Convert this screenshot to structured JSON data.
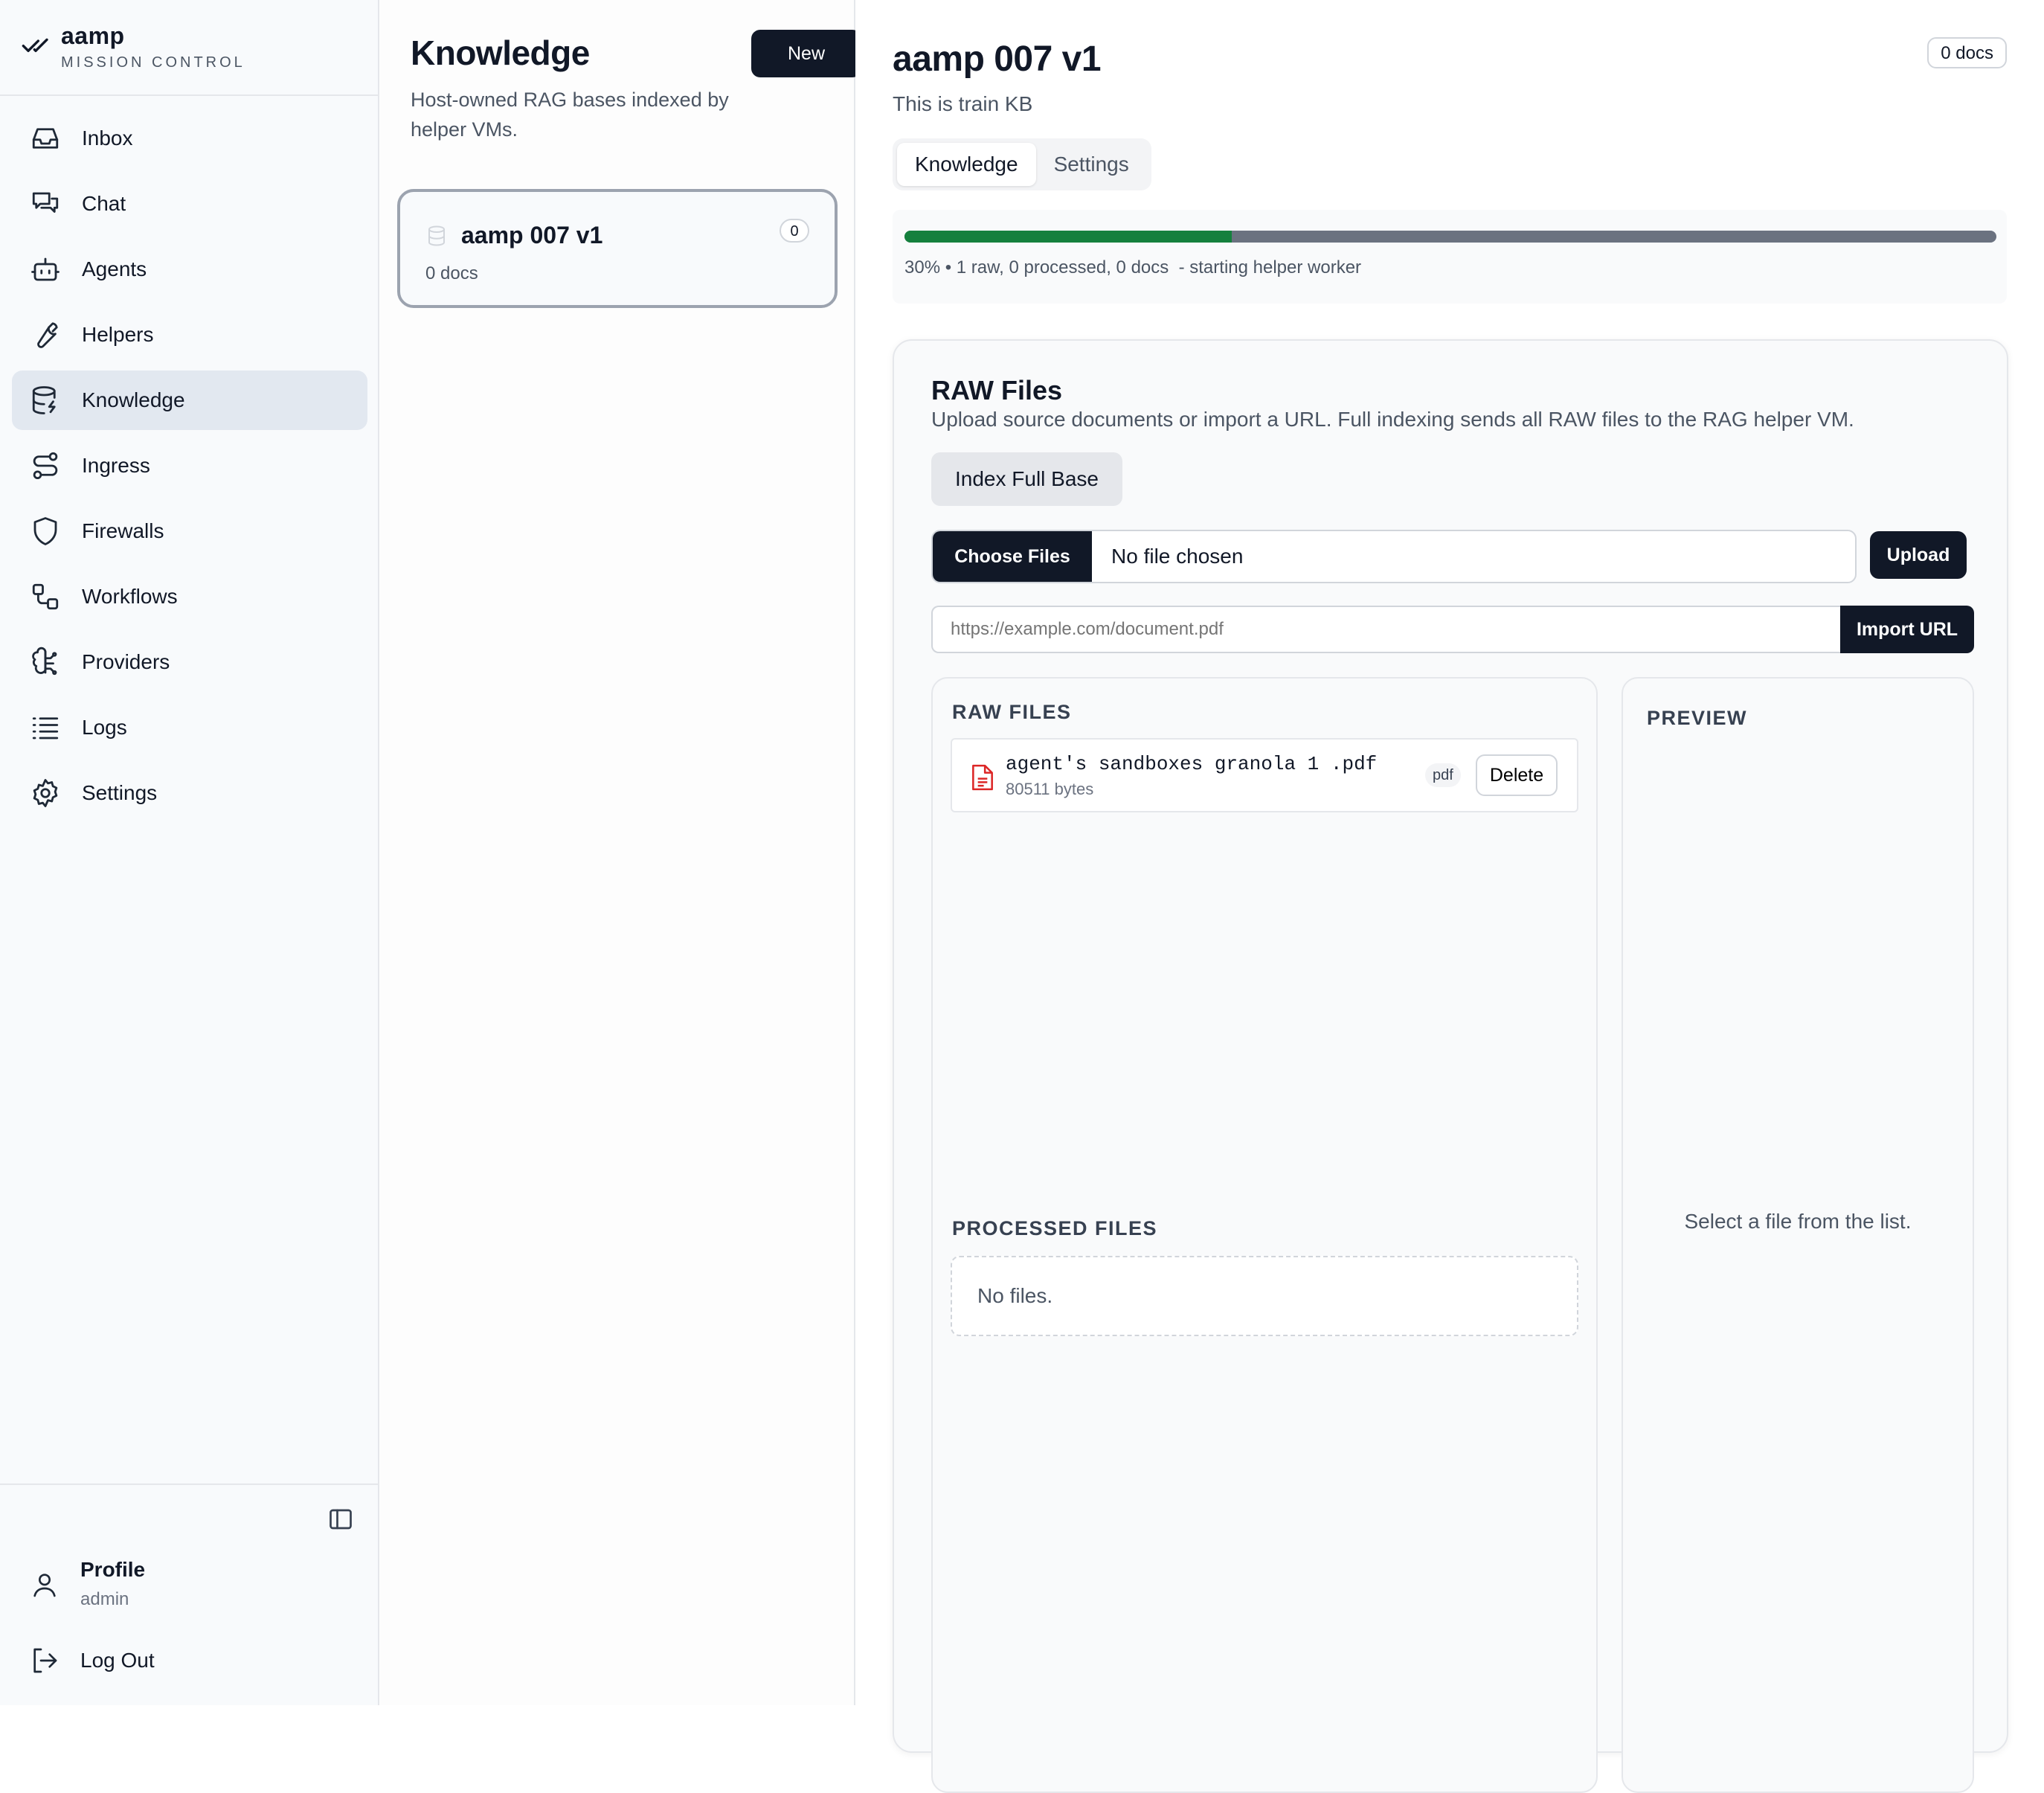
{
  "brand": {
    "name": "aamp",
    "subtitle": "MISSION CONTROL"
  },
  "sidebar": {
    "items": [
      {
        "label": "Inbox",
        "icon": "inbox-icon"
      },
      {
        "label": "Chat",
        "icon": "chat-icon"
      },
      {
        "label": "Agents",
        "icon": "bot-icon"
      },
      {
        "label": "Helpers",
        "icon": "wrench-icon"
      },
      {
        "label": "Knowledge",
        "icon": "database-icon",
        "active": true
      },
      {
        "label": "Ingress",
        "icon": "route-icon"
      },
      {
        "label": "Firewalls",
        "icon": "shield-icon"
      },
      {
        "label": "Workflows",
        "icon": "workflow-icon"
      },
      {
        "label": "Providers",
        "icon": "brain-icon"
      },
      {
        "label": "Logs",
        "icon": "list-icon"
      },
      {
        "label": "Settings",
        "icon": "gear-icon"
      }
    ],
    "profile": {
      "label": "Profile",
      "user": "admin"
    },
    "logout_label": "Log Out"
  },
  "knowledge_list": {
    "title": "Knowledge",
    "description": "Host-owned RAG bases indexed by helper VMs.",
    "new_label": "New",
    "items": [
      {
        "name": "aamp 007 v1",
        "docs": "0 docs",
        "count": "0"
      }
    ]
  },
  "detail": {
    "title": "aamp 007 v1",
    "subtitle": "This is train KB",
    "docs_badge": "0 docs",
    "tabs": [
      {
        "label": "Knowledge",
        "active": true
      },
      {
        "label": "Settings"
      }
    ],
    "progress": {
      "percent": 30,
      "text": "30% • 1 raw, 0 processed, 0 docs  - starting helper worker",
      "fill_color": "#15803d",
      "track_color": "#6b7280"
    },
    "raw": {
      "title": "RAW Files",
      "description": "Upload source documents or import a URL. Full indexing sends all RAW files to the RAG helper VM.",
      "index_label": "Index Full Base",
      "choose_label": "Choose Files",
      "no_file": "No file chosen",
      "upload_label": "Upload",
      "url_placeholder": "https://example.com/document.pdf",
      "import_label": "Import URL",
      "raw_header": "RAW FILES",
      "files": [
        {
          "name": "agent's sandboxes granola 1 .pdf",
          "size": "80511 bytes",
          "ext": "pdf",
          "delete_label": "Delete"
        }
      ],
      "processed_header": "PROCESSED FILES",
      "processed_empty": "No files.",
      "preview_header": "PREVIEW",
      "preview_empty": "Select a file from the list."
    }
  }
}
